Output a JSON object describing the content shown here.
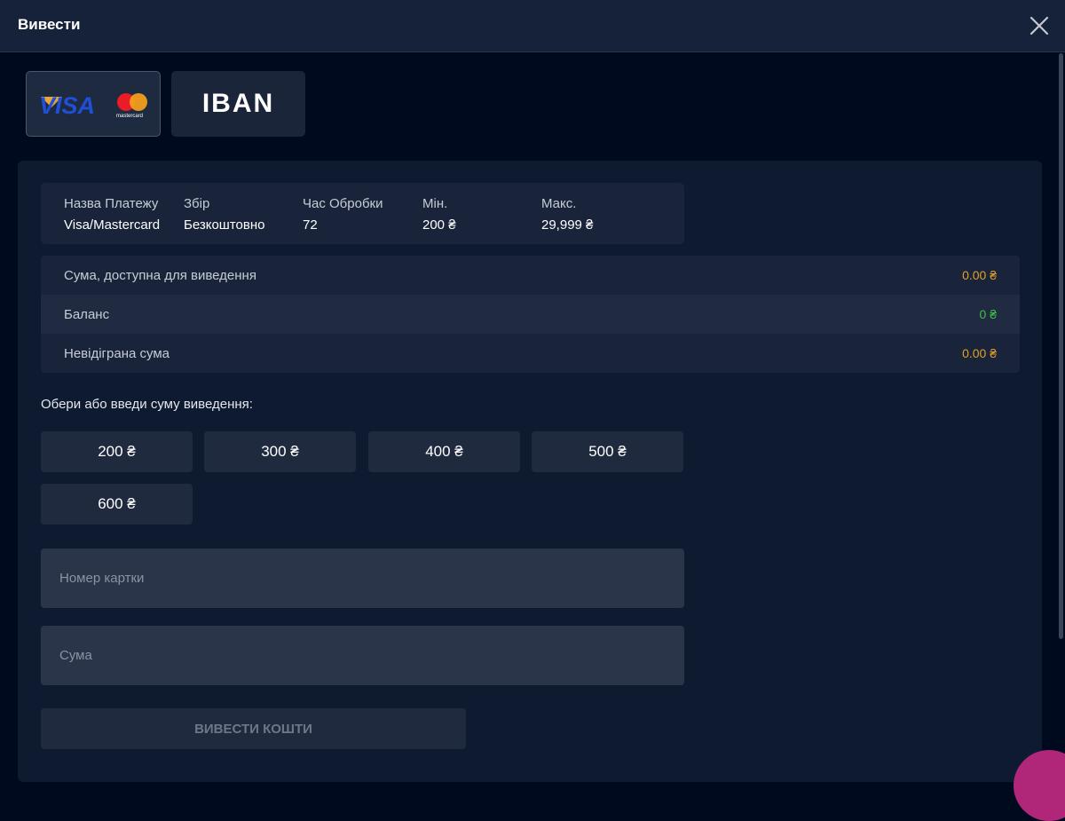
{
  "dialog": {
    "title": "Вивести"
  },
  "methods": [
    {
      "name": "Visa/Mastercard",
      "logo_text": "VISA",
      "sub_logo": "mastercard",
      "active": true
    },
    {
      "name": "IBAN",
      "label": "IBAN",
      "active": false
    }
  ],
  "payment_info": [
    {
      "label": "Назва Платежу",
      "value": "Visa/Mastercard"
    },
    {
      "label": "Збір",
      "value": "Безкоштовно"
    },
    {
      "label": "Час Обробки",
      "value": "72"
    },
    {
      "label": "Мін.",
      "value": "200 ₴"
    },
    {
      "label": "Макс.",
      "value": "29,999 ₴"
    }
  ],
  "balances": [
    {
      "label": "Сума, доступна для виведення",
      "value": "0.00 ₴",
      "color": "#e0a02a"
    },
    {
      "label": "Баланс",
      "value": "0 ₴",
      "color": "#3fbf4a"
    },
    {
      "label": "Невідіграна сума",
      "value": "0.00 ₴",
      "color": "#e0a02a"
    }
  ],
  "amount_prompt": "Обери або введи суму виведення:",
  "amounts": [
    "200 ₴",
    "300 ₴",
    "400 ₴",
    "500 ₴",
    "600 ₴"
  ],
  "fields": {
    "card_number": {
      "value": "",
      "placeholder": "Номер картки"
    },
    "amount": {
      "value": "",
      "placeholder": "Сума"
    }
  },
  "submit_label": "ВИВЕСТИ КОШТИ",
  "icons": {
    "close": "close-icon",
    "visa": "visa-logo-icon",
    "mastercard": "mastercard-logo-icon"
  },
  "colors": {
    "background": "#000a1f",
    "accent_orange": "#e0a02a",
    "accent_green": "#3fbf4a"
  }
}
